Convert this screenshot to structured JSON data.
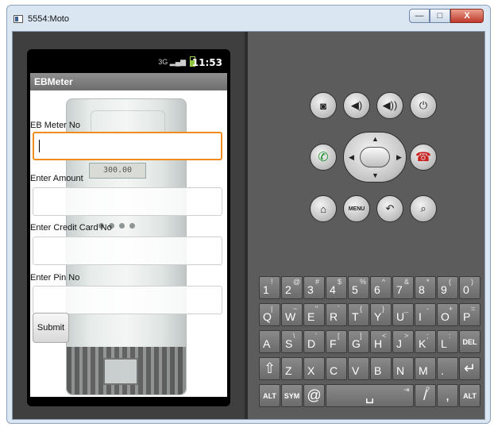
{
  "window": {
    "title": "5554:Moto",
    "buttons": {
      "minimize": "—",
      "maximize": "□",
      "close": "X"
    }
  },
  "status_bar": {
    "time": "11:53",
    "signal_text": "3G",
    "icons": [
      "data-activity-icon",
      "signal-icon",
      "battery-icon"
    ]
  },
  "app": {
    "title": "EBMeter",
    "fields": [
      {
        "label": "EB Meter No",
        "value": "",
        "focused": true
      },
      {
        "label": "Enter Amount",
        "value": "",
        "focused": false
      },
      {
        "label": "Enter Credit Card No",
        "value": "",
        "focused": false
      },
      {
        "label": "Enter Pin No",
        "value": "",
        "focused": false
      }
    ],
    "submit_label": "Submit",
    "meter_display": "300.00"
  },
  "controls": {
    "row1": [
      "camera-icon",
      "volume-down-icon",
      "volume-up-icon",
      "power-icon"
    ],
    "row2": [
      "call-icon",
      "dpad",
      "end-call-icon"
    ],
    "row3": [
      "home-icon",
      "menu-button",
      "back-icon",
      "search-icon"
    ],
    "menu_label": "MENU"
  },
  "keyboard": {
    "row1": [
      {
        "m": "1",
        "a": "!"
      },
      {
        "m": "2",
        "a": "@"
      },
      {
        "m": "3",
        "a": "#"
      },
      {
        "m": "4",
        "a": "$"
      },
      {
        "m": "5",
        "a": "%"
      },
      {
        "m": "6",
        "a": "^"
      },
      {
        "m": "7",
        "a": "&"
      },
      {
        "m": "8",
        "a": "*"
      },
      {
        "m": "9",
        "a": "("
      },
      {
        "m": "0",
        "a": ")"
      }
    ],
    "row2": [
      {
        "m": "Q",
        "a": "|"
      },
      {
        "m": "W",
        "a": "~"
      },
      {
        "m": "E",
        "a": "\""
      },
      {
        "m": "R",
        "a": "`"
      },
      {
        "m": "T",
        "a": "{"
      },
      {
        "m": "Y",
        "a": "}"
      },
      {
        "m": "U",
        "a": "_"
      },
      {
        "m": "I",
        "a": "-"
      },
      {
        "m": "O",
        "a": "+"
      },
      {
        "m": "P",
        "a": "="
      }
    ],
    "row3": [
      {
        "m": "A",
        "a": ""
      },
      {
        "m": "S",
        "a": "\\"
      },
      {
        "m": "D",
        "a": "'"
      },
      {
        "m": "F",
        "a": "["
      },
      {
        "m": "G",
        "a": "]"
      },
      {
        "m": "H",
        "a": "<"
      },
      {
        "m": "J",
        "a": ">"
      },
      {
        "m": "K",
        "a": ";"
      },
      {
        "m": "L",
        "a": ":"
      },
      {
        "m": "DEL",
        "a": ""
      }
    ],
    "row4": [
      {
        "m": "⇧",
        "a": ""
      },
      {
        "m": "Z",
        "a": ""
      },
      {
        "m": "X",
        "a": ""
      },
      {
        "m": "C",
        "a": ""
      },
      {
        "m": "V",
        "a": ""
      },
      {
        "m": "B",
        "a": ""
      },
      {
        "m": "N",
        "a": ""
      },
      {
        "m": "M",
        "a": ""
      },
      {
        "m": ".",
        "a": ""
      },
      {
        "m": "↵",
        "a": ""
      }
    ],
    "row5": [
      {
        "m": "ALT",
        "a": ""
      },
      {
        "m": "SYM",
        "a": ""
      },
      {
        "m": "@",
        "a": ""
      },
      {
        "m": "␣",
        "a": "⇥"
      },
      {
        "m": "/",
        "a": "?"
      },
      {
        "m": ",",
        "a": ""
      },
      {
        "m": "ALT",
        "a": ""
      }
    ]
  }
}
